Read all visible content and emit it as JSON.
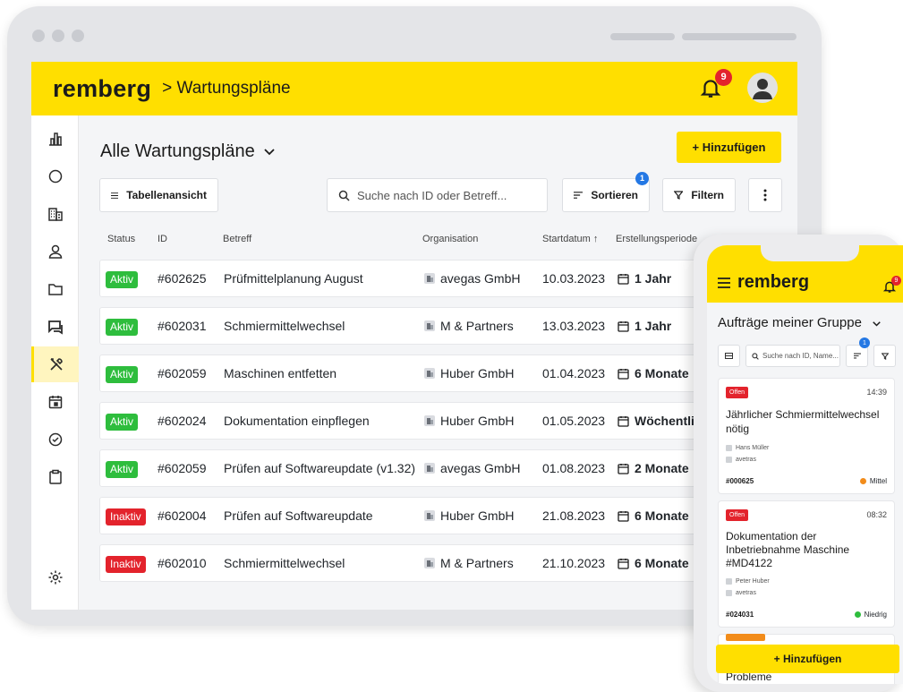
{
  "app": {
    "logo": "remberg",
    "breadcrumb": "> Wartungspläne",
    "notifications": "9"
  },
  "sidebar": {
    "icons": [
      "chart-icon",
      "circle-icon",
      "building-icon",
      "user-icon",
      "folder-icon",
      "chat-icon",
      "tools-icon",
      "calendar-icon",
      "check-circle-icon",
      "clipboard-icon",
      "settings-icon"
    ],
    "active": "tools-icon"
  },
  "page": {
    "title": "Alle Wartungspläne",
    "add_label": "+ Hinzufügen",
    "view_label": "Tabellenansicht",
    "search_placeholder": "Suche nach ID oder Betreff...",
    "sort_label": "Sortieren",
    "sort_badge": "1",
    "filter_label": "Filtern"
  },
  "table": {
    "columns": [
      "Status",
      "ID",
      "Betreff",
      "Organisation",
      "Startdatum ↑",
      "Erstellungsperiode"
    ],
    "rows": [
      {
        "status": "Aktiv",
        "id": "#602625",
        "betreff": "Prüfmittelplanung August",
        "org": "avegas GmbH",
        "start": "10.03.2023",
        "period": "1 Jahr"
      },
      {
        "status": "Aktiv",
        "id": "#602031",
        "betreff": "Schmiermittelwechsel",
        "org": "M & Partners",
        "start": "13.03.2023",
        "period": "1 Jahr"
      },
      {
        "status": "Aktiv",
        "id": "#602059",
        "betreff": "Maschinen entfetten",
        "org": "Huber GmbH",
        "start": "01.04.2023",
        "period": "6 Monate"
      },
      {
        "status": "Aktiv",
        "id": "#602024",
        "betreff": "Dokumentation einpflegen",
        "org": "Huber GmbH",
        "start": "01.05.2023",
        "period": "Wöchentlic"
      },
      {
        "status": "Aktiv",
        "id": "#602059",
        "betreff": "Prüfen auf Softwareupdate (v1.32)",
        "org": "avegas GmbH",
        "start": "01.08.2023",
        "period": "2 Monate"
      },
      {
        "status": "Inaktiv",
        "id": "#602004",
        "betreff": "Prüfen auf Softwareupdate",
        "org": "Huber GmbH",
        "start": "21.08.2023",
        "period": "6 Monate"
      },
      {
        "status": "Inaktiv",
        "id": "#602010",
        "betreff": "Schmiermittelwechsel",
        "org": "M & Partners",
        "start": "21.10.2023",
        "period": "6 Monate"
      }
    ]
  },
  "mobile": {
    "logo": "remberg",
    "title": "Aufträge meiner Gruppe",
    "search_placeholder": "Suche nach ID, Name...",
    "sort_badge": "1",
    "cards": [
      {
        "status": "Offen",
        "time": "14:39",
        "title": "Jährlicher Schmiermittelwechsel nötig",
        "person": "Hans Müller",
        "org": "avetras",
        "id": "#000625",
        "priority": "Mittel",
        "priority_color": "#f28c1b"
      },
      {
        "status": "Offen",
        "time": "08:32",
        "title": "Dokumentation der Inbetriebnahme Maschine #MD4122",
        "person": "Peter Huber",
        "org": "avetras",
        "id": "#024031",
        "priority": "Niedrig",
        "priority_color": "#2ebd3d"
      }
    ],
    "partial_card_title": "Probleme",
    "add_label": "+ Hinzufügen"
  }
}
